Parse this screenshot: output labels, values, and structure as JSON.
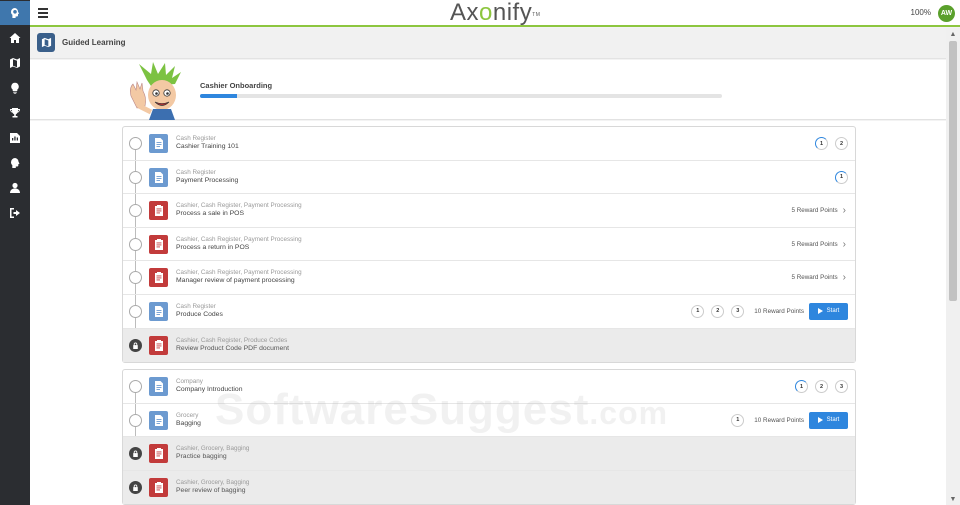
{
  "header": {
    "logo": {
      "left": "Ax",
      "o": "o",
      "right": "nify",
      "tm": "TM"
    },
    "zoom": "100%",
    "user_initials": "AW"
  },
  "breadcrumb": {
    "title": "Guided Learning"
  },
  "course": {
    "title": "Cashier Onboarding",
    "progress_fraction": 0.07
  },
  "sidebar": {
    "items": [
      {
        "icon": "brain-logo-icon",
        "active": true
      },
      {
        "icon": "home-icon",
        "active": false
      },
      {
        "icon": "map-icon",
        "active": false
      },
      {
        "icon": "lightbulb-icon",
        "active": false
      },
      {
        "icon": "trophy-icon",
        "active": false
      },
      {
        "icon": "chart-icon",
        "active": false
      },
      {
        "icon": "head-icon",
        "active": false
      },
      {
        "icon": "user-icon",
        "active": false
      },
      {
        "icon": "logout-icon",
        "active": false
      }
    ]
  },
  "groups": [
    {
      "rows": [
        {
          "type": "doc",
          "locked": false,
          "category": "Cash Register",
          "name": "Cashier Training 101",
          "rounds": [
            "1",
            "2"
          ],
          "partial_round": 0,
          "points": "",
          "chevron": false,
          "start": false
        },
        {
          "type": "doc",
          "locked": false,
          "category": "Cash Register",
          "name": "Payment Processing",
          "rounds": [
            "1"
          ],
          "partial_round": 0,
          "points": "",
          "chevron": false,
          "start": false
        },
        {
          "type": "task",
          "locked": false,
          "category": "Cashier, Cash Register, Payment Processing",
          "name": "Process a sale in POS",
          "rounds": [],
          "partial_round": -1,
          "points": "5 Reward Points",
          "chevron": true,
          "start": false
        },
        {
          "type": "task",
          "locked": false,
          "category": "Cashier, Cash Register, Payment Processing",
          "name": "Process a return in POS",
          "rounds": [],
          "partial_round": -1,
          "points": "5 Reward Points",
          "chevron": true,
          "start": false
        },
        {
          "type": "task",
          "locked": false,
          "category": "Cashier, Cash Register, Payment Processing",
          "name": "Manager review of payment processing",
          "rounds": [],
          "partial_round": -1,
          "points": "5 Reward Points",
          "chevron": true,
          "start": false
        },
        {
          "type": "doc",
          "locked": false,
          "category": "Cash Register",
          "name": "Produce Codes",
          "rounds": [
            "1",
            "2",
            "3"
          ],
          "partial_round": -1,
          "points": "10 Reward Points",
          "chevron": false,
          "start": true
        },
        {
          "type": "task",
          "locked": true,
          "category": "Cashier, Cash Register, Produce Codes",
          "name": "Review Product Code PDF document",
          "rounds": [],
          "partial_round": -1,
          "points": "",
          "chevron": false,
          "start": false
        }
      ]
    },
    {
      "rows": [
        {
          "type": "doc",
          "locked": false,
          "category": "Company",
          "name": "Company Introduction",
          "rounds": [
            "1",
            "2",
            "3"
          ],
          "partial_round": 0,
          "points": "",
          "chevron": false,
          "start": false
        },
        {
          "type": "doc",
          "locked": false,
          "category": "Grocery",
          "name": "Bagging",
          "rounds": [
            "1"
          ],
          "partial_round": -1,
          "points": "10 Reward Points",
          "chevron": false,
          "start": true
        },
        {
          "type": "task",
          "locked": true,
          "category": "Cashier, Grocery, Bagging",
          "name": "Practice bagging",
          "rounds": [],
          "partial_round": -1,
          "points": "",
          "chevron": false,
          "start": false
        },
        {
          "type": "task",
          "locked": true,
          "category": "Cashier, Grocery, Bagging",
          "name": "Peer review of bagging",
          "rounds": [],
          "partial_round": -1,
          "points": "",
          "chevron": false,
          "start": false
        }
      ]
    }
  ],
  "start_label": "Start",
  "chevron_glyph": "›",
  "watermark": {
    "text": "SoftwareSuggest",
    "suffix": ".com"
  },
  "colors": {
    "accent_blue": "#2e86de",
    "brand_green": "#8dc63f",
    "task_red": "#c23b3b",
    "doc_blue": "#6c9ad0",
    "sidebar_bg": "#2b2d31"
  }
}
